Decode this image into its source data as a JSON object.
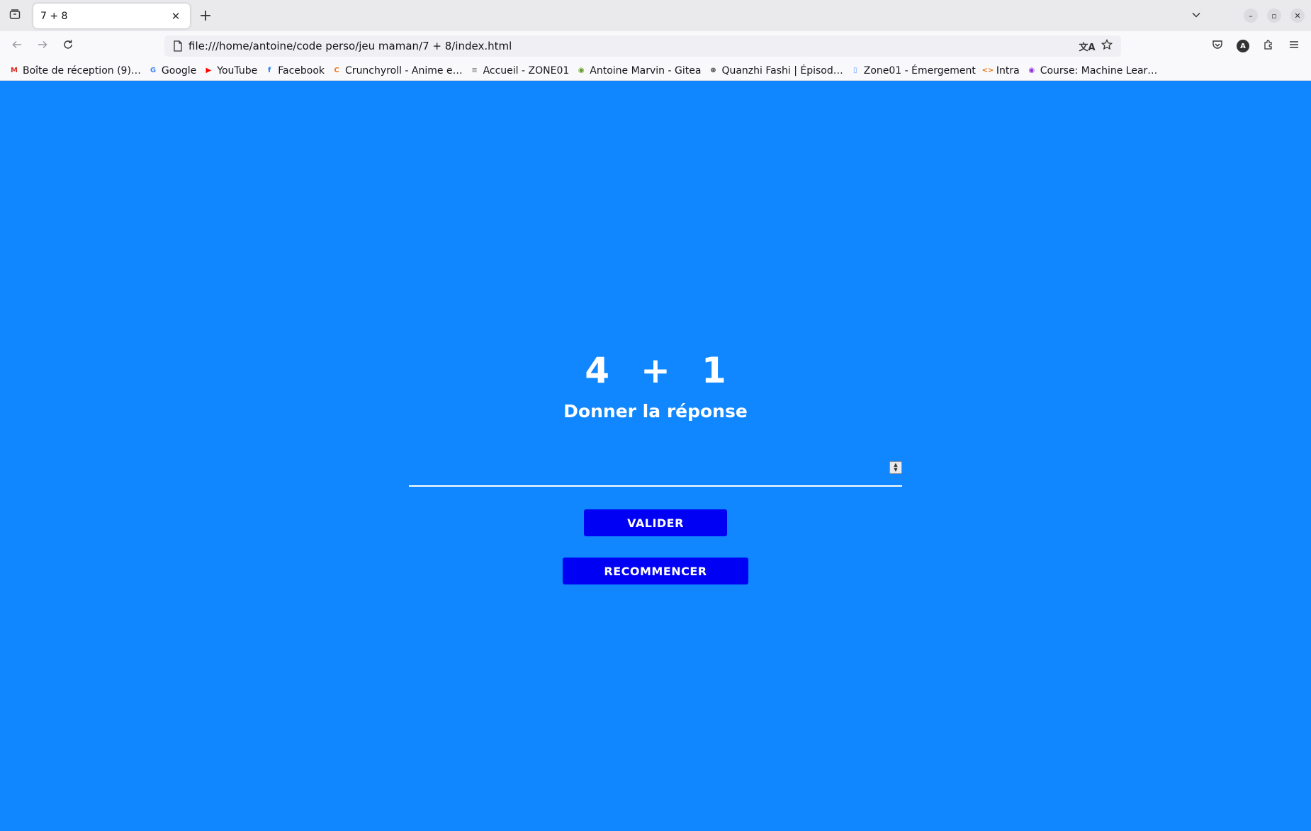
{
  "browser": {
    "tab": {
      "title": "7 + 8"
    },
    "url": "file:///home/antoine/code perso/jeu maman/7 + 8/index.html",
    "profile_initial": "A"
  },
  "bookmarks": [
    {
      "label": "Boîte de réception (9)…",
      "icon": "gmail-icon",
      "color": "#d93025",
      "glyph": "M"
    },
    {
      "label": "Google",
      "icon": "google-icon",
      "color": "#4285f4",
      "glyph": "G"
    },
    {
      "label": "YouTube",
      "icon": "youtube-icon",
      "color": "#ff0000",
      "glyph": "▶"
    },
    {
      "label": "Facebook",
      "icon": "facebook-icon",
      "color": "#1877f2",
      "glyph": "f"
    },
    {
      "label": "Crunchyroll - Anime e…",
      "icon": "crunchyroll-icon",
      "color": "#f47521",
      "glyph": "C"
    },
    {
      "label": "Accueil - ZONE01",
      "icon": "zone01-icon",
      "color": "#888888",
      "glyph": "≡"
    },
    {
      "label": "Antoine Marvin - Gitea",
      "icon": "gitea-icon",
      "color": "#609926",
      "glyph": "◉"
    },
    {
      "label": "Quanzhi Fashi | Épisod…",
      "icon": "globe-icon",
      "color": "#333333",
      "glyph": "⊕"
    },
    {
      "label": "Zone01 - Émergement",
      "icon": "zone01-emargement-icon",
      "color": "#6aa0ff",
      "glyph": "▯"
    },
    {
      "label": "Intra",
      "icon": "code-icon",
      "color": "#e8710a",
      "glyph": "<>"
    },
    {
      "label": "Course: Machine Lear…",
      "icon": "course-icon",
      "color": "#8b2be2",
      "glyph": "◉"
    }
  ],
  "game": {
    "operand_a": "4",
    "operator": "+",
    "operand_b": "1",
    "prompt": "Donner la réponse",
    "answer_value": "",
    "submit_label": "VALIDER",
    "restart_label": "RECOMMENCER"
  },
  "colors": {
    "page_background": "#1087ff",
    "button_background": "#0000f5",
    "text": "#ffffff"
  }
}
